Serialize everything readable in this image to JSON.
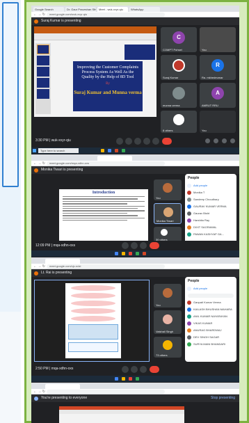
{
  "shot1": {
    "tabs": [
      "Google Search",
      "Dr. Gaur Praveshan Stha...",
      "Meet - wuk-xvyr-qiu",
      "WhatsApp"
    ],
    "url": "meet.google.com/wuk-xvyr-qiu",
    "presenter": "Suraj Kumar is presenting",
    "slide_title": "Improving the Customer Complaints Process System As Well As the Quality by the Help of 8D Tool",
    "slide_by": "By",
    "slide_names": "Suraj Kumar and Munna verma",
    "participants": [
      {
        "name": "COMPT Pohsel",
        "initial": "C",
        "color": "#8e44ad"
      },
      {
        "name": "You",
        "initial": "",
        "color": "#5f6368"
      },
      {
        "name": "Suraj Kumar",
        "initial": "",
        "color": "#c0392b"
      },
      {
        "name": "Ra. mkhedeumar",
        "initial": "R",
        "color": "#1a73e8"
      },
      {
        "name": "munna verma",
        "initial": "",
        "color": "#7f8c8d"
      },
      {
        "name": "AMRUT RRU",
        "initial": "A",
        "color": "#8e44ad"
      },
      {
        "name": "8 others",
        "initial": "",
        "color": "#5f6368"
      }
    ],
    "clock": "3:30 PM | wuk-xvyr-qiu",
    "taskbar_search": "Type here to search"
  },
  "shot2": {
    "url": "meet.google.com/mqa-xdhn-oxs",
    "presenter": "Monika Tiwari is presenting",
    "slide_title": "Introduction",
    "people_header": "People",
    "add_people": "Add people",
    "people": [
      "Monika T",
      "Sandeep Choudhary",
      "GAURAV KUMAR VERMA",
      "Gaurav Bisht",
      "Harshita Ray",
      "DIXIT SAGRAWAL",
      "PAWAN KASHYAP GA..."
    ],
    "tiles": [
      {
        "name": "You"
      },
      {
        "name": "Monika Tiwari"
      },
      {
        "name": "30 others"
      }
    ],
    "clock": "12:09 PM | mqa-xdhn-oxs"
  },
  "shot3": {
    "url": "meet.google.com/xjv-ndzi",
    "presenter": "Lt. Rai is presenting",
    "people_header": "People",
    "add_people": "Add people",
    "people": [
      "Ganpati Kumar Verma",
      "KAILASH BHUSHAN MAHARA",
      "ANIL KUMAR NAYARAYAN",
      "VIKAS KUMAR",
      "ANURAG BHARDWAJ",
      "DEV SINGH SAGAR",
      "SURYA MANI BHANDARI"
    ],
    "tiles": [
      {
        "name": "You"
      },
      {
        "name": "Vaishali Singh"
      },
      {
        "name": "73 others"
      }
    ],
    "self_name": "Lt. Rai",
    "clock": "2:50 PM | mqa-xdhn-oxs"
  },
  "shot4": {
    "presenter": "You're presenting to everyone",
    "stop_label": "Stop presenting"
  },
  "colors": {
    "frame_border": "#7cb240",
    "frame_bg": "#d7ecbd",
    "left_card_border": "#2f7fd0",
    "meet_dark": "#202124",
    "end_call_red": "#ea4335"
  }
}
